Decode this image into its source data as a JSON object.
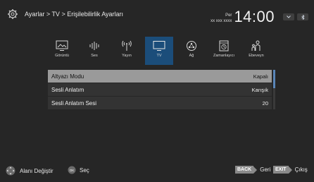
{
  "header": {
    "breadcrumb": "Ayarlar > TV > Erişilebilirlik Ayarları",
    "day": "Per",
    "date": "xx xxx xxxx",
    "time": "14:00",
    "btn_left_icon": "chevron-down-icon",
    "btn_right_icon": "bluetooth-icon"
  },
  "categories": [
    {
      "label": "Görüntü",
      "icon": "picture-icon"
    },
    {
      "label": "Ses",
      "icon": "sound-icon"
    },
    {
      "label": "Yayın",
      "icon": "antenna-icon"
    },
    {
      "label": "TV",
      "icon": "tv-icon",
      "active": true
    },
    {
      "label": "Ağ",
      "icon": "network-icon"
    },
    {
      "label": "Zamanlayıcı",
      "icon": "timer-icon"
    },
    {
      "label": "Ebeveyn",
      "icon": "parental-icon"
    }
  ],
  "menu": [
    {
      "label": "Altyazı Modu",
      "value": "Kapalı",
      "selected": true
    },
    {
      "label": "Sesli Anlatım",
      "value": "Karışık"
    },
    {
      "label": "Sesli Anlatım Sesi",
      "value": "20"
    }
  ],
  "footer": {
    "change_area": "Alanı Değiştir",
    "ok_key": "OK",
    "select": "Seç",
    "back_key": "BACK",
    "back": "Geri",
    "exit_key": "EXIT",
    "exit": "Çıkış"
  },
  "colors": {
    "active_category": "#1b4d7a",
    "selected_row": "#9a9a9a",
    "row_bg": "#333333",
    "scroll_thumb": "#5a86b8"
  }
}
